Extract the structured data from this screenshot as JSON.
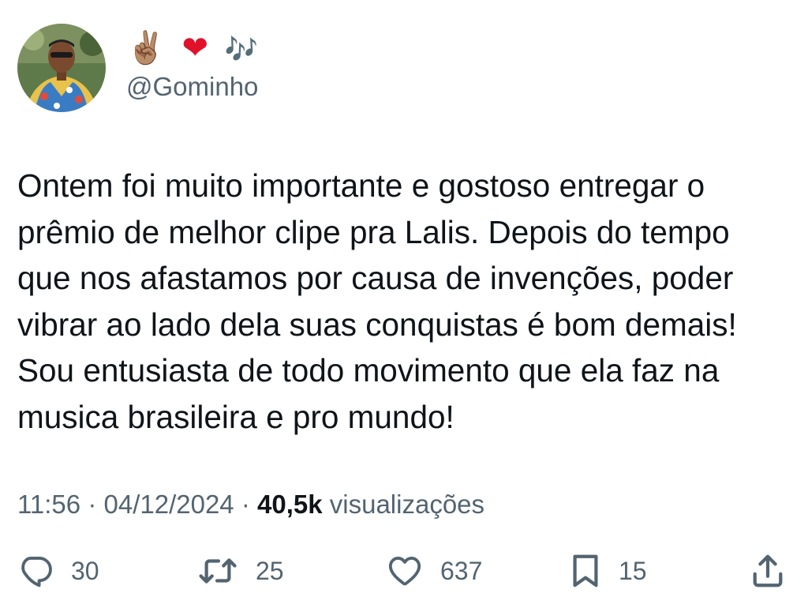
{
  "author": {
    "display_name": {
      "hand": "✌🏽",
      "heart": "❤",
      "notes": "🎶"
    },
    "handle": "@Gominho"
  },
  "tweet": {
    "text": "Ontem foi muito importante e gostoso entregar o\nprêmio de melhor clipe pra Lalis. Depois do tempo\nque nos afastamos por causa de invenções, poder\nvibrar ao lado dela suas conquistas é bom demais!\nSou entusiasta de todo movimento que ela faz na\nmusica brasileira e pro mundo!",
    "time": "11:56",
    "separator": "·",
    "date": "04/12/2024",
    "views_count": "40,5k",
    "views_label": "visualizações"
  },
  "actions": {
    "reply": {
      "icon": "reply-icon",
      "count": "30"
    },
    "retweet": {
      "icon": "retweet-icon",
      "count": "25"
    },
    "like": {
      "icon": "heart-icon",
      "count": "637"
    },
    "bookmark": {
      "icon": "bookmark-icon",
      "count": "15"
    },
    "share": {
      "icon": "share-icon"
    }
  },
  "colors": {
    "text_primary": "#0f1419",
    "text_secondary": "#536471",
    "heart_emoji": "#e0122a",
    "background": "#ffffff"
  }
}
